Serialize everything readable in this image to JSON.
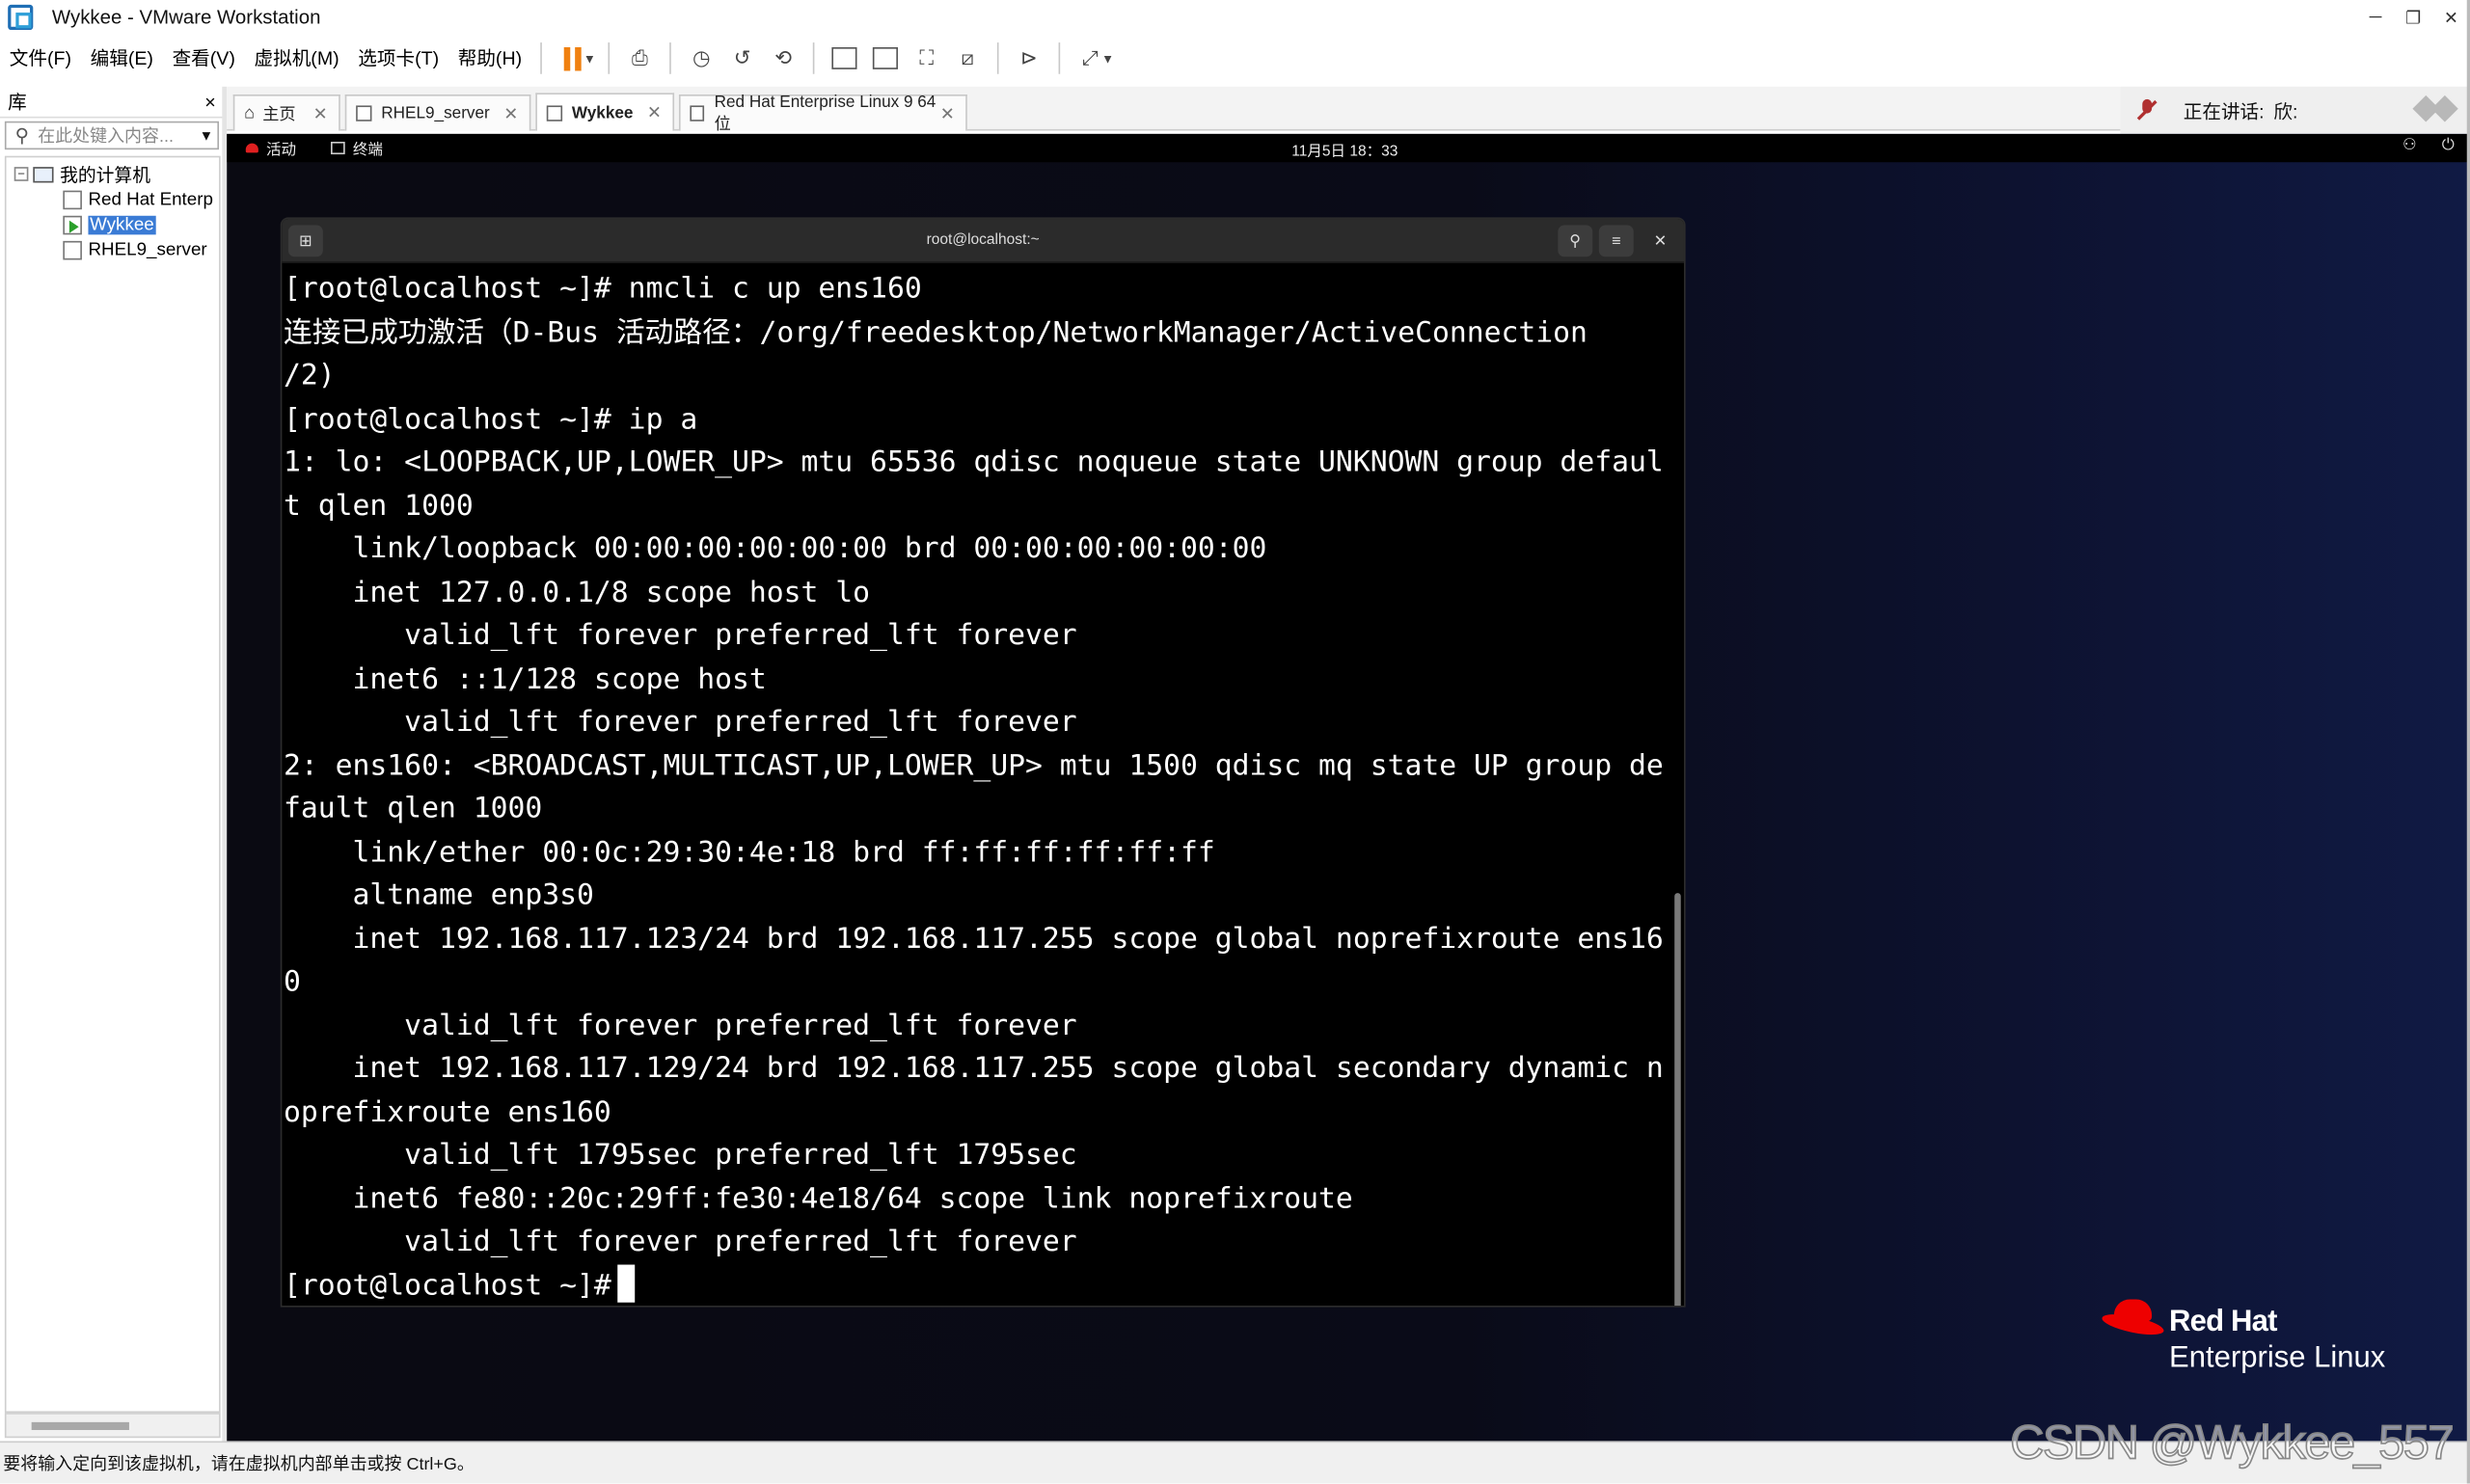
{
  "window": {
    "title": "Wykkee - VMware Workstation"
  },
  "menu": [
    "文件(F)",
    "编辑(E)",
    "查看(V)",
    "虚拟机(M)",
    "选项卡(T)",
    "帮助(H)"
  ],
  "library": {
    "title": "库",
    "close": "×",
    "search_placeholder": "在此处键入内容...",
    "root": "我的计算机",
    "items": [
      "Red Hat Enterp",
      "Wykkee",
      "RHEL9_server"
    ],
    "selected": "Wykkee"
  },
  "tabs": [
    {
      "label": "主页",
      "active": false
    },
    {
      "label": "RHEL9_server",
      "active": false
    },
    {
      "label": "Wykkee",
      "active": true
    },
    {
      "label": "Red Hat Enterprise Linux 9 64 位",
      "active": false
    }
  ],
  "talk": {
    "label": "正在讲话:",
    "name": "欣:"
  },
  "gnome": {
    "activities": "活动",
    "app": "终端",
    "clock": "11月5日 18：33"
  },
  "terminal": {
    "title": "root@localhost:~",
    "lines": [
      "[root@localhost ~]# nmcli c up ens160",
      "连接已成功激活（D-Bus 活动路径：/org/freedesktop/NetworkManager/ActiveConnection",
      "/2)",
      "[root@localhost ~]# ip a",
      "1: lo: <LOOPBACK,UP,LOWER_UP> mtu 65536 qdisc noqueue state UNKNOWN group defaul",
      "t qlen 1000",
      "    link/loopback 00:00:00:00:00:00 brd 00:00:00:00:00:00",
      "    inet 127.0.0.1/8 scope host lo",
      "       valid_lft forever preferred_lft forever",
      "    inet6 ::1/128 scope host",
      "       valid_lft forever preferred_lft forever",
      "2: ens160: <BROADCAST,MULTICAST,UP,LOWER_UP> mtu 1500 qdisc mq state UP group de",
      "fault qlen 1000",
      "    link/ether 00:0c:29:30:4e:18 brd ff:ff:ff:ff:ff:ff",
      "    altname enp3s0",
      "    inet 192.168.117.123/24 brd 192.168.117.255 scope global noprefixroute ens16",
      "0",
      "       valid_lft forever preferred_lft forever",
      "    inet 192.168.117.129/24 brd 192.168.117.255 scope global secondary dynamic n",
      "oprefixroute ens160",
      "       valid_lft 1795sec preferred_lft 1795sec",
      "    inet6 fe80::20c:29ff:fe30:4e18/64 scope link noprefixroute",
      "       valid_lft forever preferred_lft forever"
    ],
    "prompt": "[root@localhost ~]# "
  },
  "branding": {
    "line1": "Red Hat",
    "line2": "Enterprise Linux"
  },
  "status": {
    "text": "要将输入定向到该虚拟机，请在虚拟机内部单击或按 Ctrl+G。"
  },
  "watermark": "CSDN @Wykkee_557",
  "colors": {
    "accent": "#f08010",
    "redhat": "#ee0000",
    "selection": "#3a7bd5"
  }
}
